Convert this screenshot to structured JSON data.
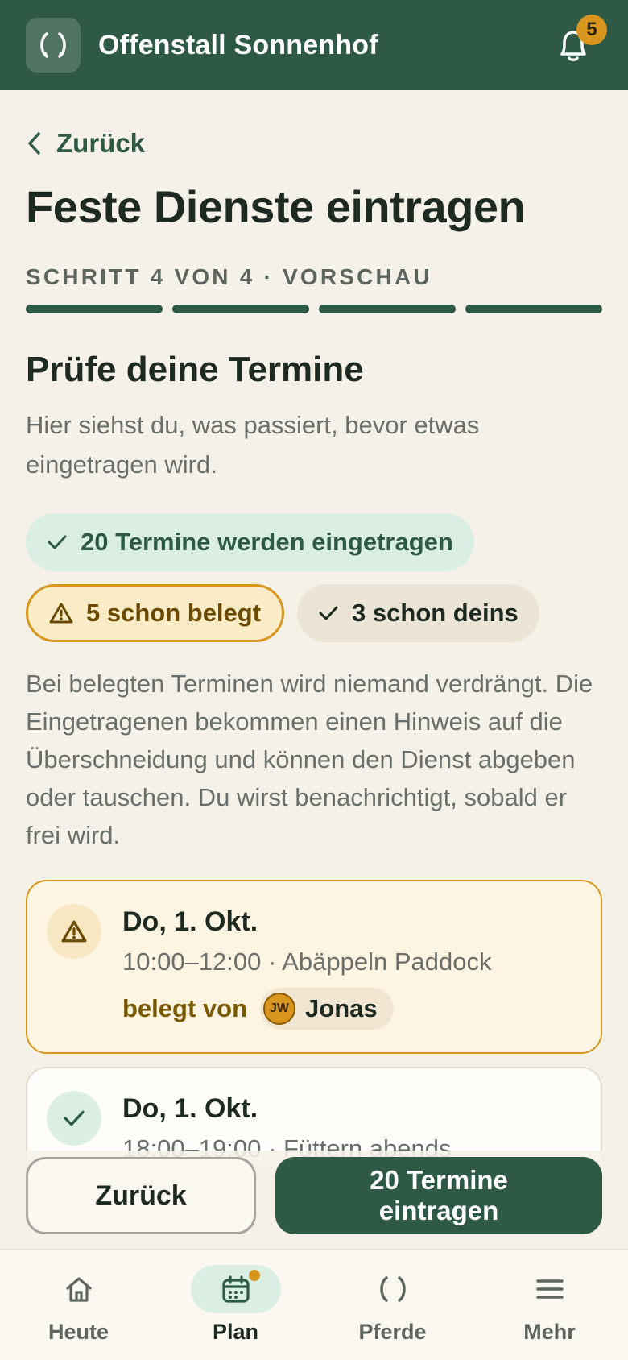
{
  "app": {
    "title": "Offenstall Sonnenhof",
    "notification_count": "5"
  },
  "nav": {
    "back_label": "Zurück"
  },
  "page": {
    "title": "Feste Dienste eintragen",
    "step_label": "SCHRITT 4 VON 4 · VORSCHAU",
    "progress": {
      "current": 4,
      "total": 4
    }
  },
  "review": {
    "title": "Prüfe deine Termine",
    "subtitle": "Hier siehst du, was passiert, bevor etwas eingetragen wird.",
    "summary_new": "20 Termine werden eingetragen",
    "summary_taken": "5 schon belegt",
    "summary_mine": "3 schon deins",
    "info": "Bei belegten Terminen wird niemand verdrängt. Die Eingetragenen bekommen einen Hinweis auf die Überschneidung und können den Dienst abgeben oder tauschen. Du wirst benachrichtigt, sobald er frei wird."
  },
  "entries": [
    {
      "status": "taken",
      "date": "Do, 1. Okt.",
      "time_task": "10:00–12:00 · Abäppeln Paddock",
      "by_label": "belegt von",
      "user_initials": "JW",
      "user_name": "Jonas"
    },
    {
      "status": "ok",
      "date": "Do, 1. Okt.",
      "time_task": "18:00–19:00 · Füttern abends"
    }
  ],
  "actions": {
    "back": "Zurück",
    "submit": "20 Termine eintragen"
  },
  "tabs": [
    {
      "label": "Heute",
      "icon": "home-icon"
    },
    {
      "label": "Plan",
      "icon": "calendar-icon",
      "active": true
    },
    {
      "label": "Pferde",
      "icon": "horseshoe-icon"
    },
    {
      "label": "Mehr",
      "icon": "menu-icon"
    }
  ],
  "colors": {
    "primary": "#2e5a45",
    "accent": "#d9961f",
    "background": "#f6f1e8"
  }
}
